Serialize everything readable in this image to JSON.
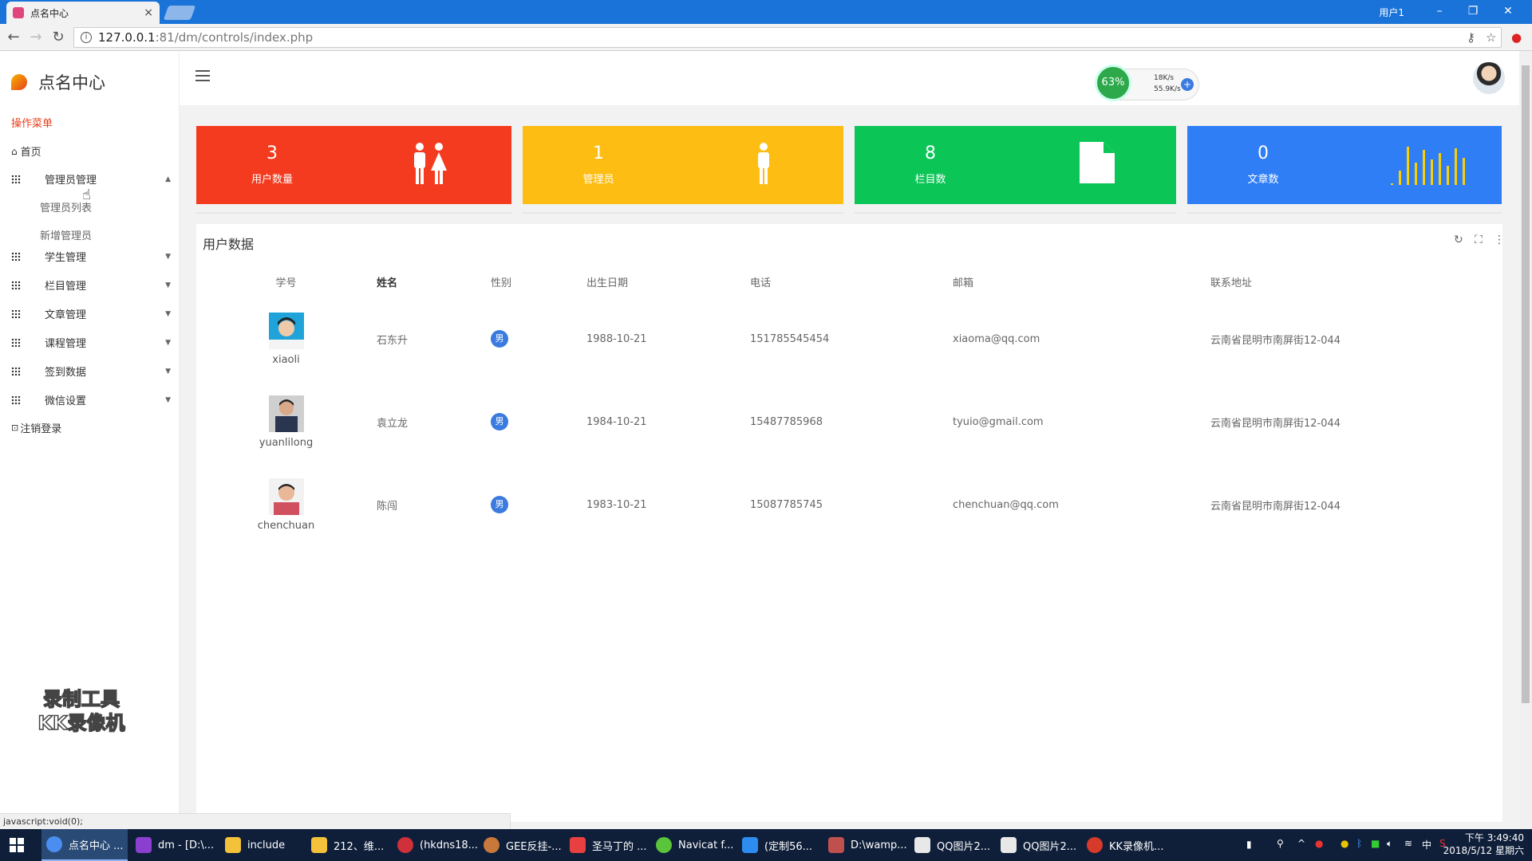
{
  "browser": {
    "tab_title": "点名中心",
    "tab_close": "×",
    "window_user": "用户1",
    "url_host": "127.0.0.1",
    "url_rest": ":81/dm/controls/index.php",
    "status_url": "javascript:void(0);"
  },
  "app": {
    "logo_text": "点名中心",
    "menu_title": "操作菜单",
    "home": "首页",
    "menu": [
      {
        "label": "管理员管理",
        "caret": "▲"
      },
      {
        "label": "学生管理",
        "caret": "▼"
      },
      {
        "label": "栏目管理",
        "caret": "▼"
      },
      {
        "label": "文章管理",
        "caret": "▼"
      },
      {
        "label": "课程管理",
        "caret": "▼"
      },
      {
        "label": "签到数据",
        "caret": "▼"
      },
      {
        "label": "微信设置",
        "caret": "▼"
      }
    ],
    "submenu": [
      "管理员列表",
      "新增管理员"
    ],
    "logout": "注销登录",
    "watermark_line1": "录制工具",
    "watermark_line2": "KK录像机"
  },
  "netmon": {
    "percent": "63%",
    "up": "18K/s",
    "down": "55.9K/s"
  },
  "stats": [
    {
      "value": "3",
      "label": "用户数量",
      "color": "#f43b1f"
    },
    {
      "value": "1",
      "label": "管理员",
      "color": "#fdbd12"
    },
    {
      "value": "8",
      "label": "栏目数",
      "color": "#0cc557"
    },
    {
      "value": "0",
      "label": "文章数",
      "color": "#2f7ef6"
    }
  ],
  "panel": {
    "title": "用户数据",
    "columns": [
      "学号",
      "姓名",
      "性别",
      "出生日期",
      "电话",
      "邮箱",
      "联系地址"
    ],
    "rows": [
      {
        "user": "xiaoli",
        "name": "石东升",
        "sex": "男",
        "birth": "1988-10-21",
        "phone": "151785545454",
        "email": "xiaoma@qq.com",
        "address": "云南省昆明市南屏街12-044"
      },
      {
        "user": "yuanlilong",
        "name": "袁立龙",
        "sex": "男",
        "birth": "1984-10-21",
        "phone": "15487785968",
        "email": "tyuio@gmail.com",
        "address": "云南省昆明市南屏街12-044"
      },
      {
        "user": "chenchuan",
        "name": "陈闯",
        "sex": "男",
        "birth": "1983-10-21",
        "phone": "15087785745",
        "email": "chenchuan@qq.com",
        "address": "云南省昆明市南屏街12-044"
      }
    ]
  },
  "taskbar": {
    "items": [
      "点名中心 ...",
      "dm - [D:\\...",
      "include",
      "212、维...",
      "(hkdns18...",
      "GEE反挂-...",
      "圣马丁的 ...",
      "Navicat f...",
      "(定制56...",
      "D:\\wamp...",
      "QQ图片2...",
      "QQ图片2...",
      "KK录像机..."
    ],
    "ime": "中",
    "time": "下午 3:49:40",
    "date": "2018/5/12 星期六"
  }
}
